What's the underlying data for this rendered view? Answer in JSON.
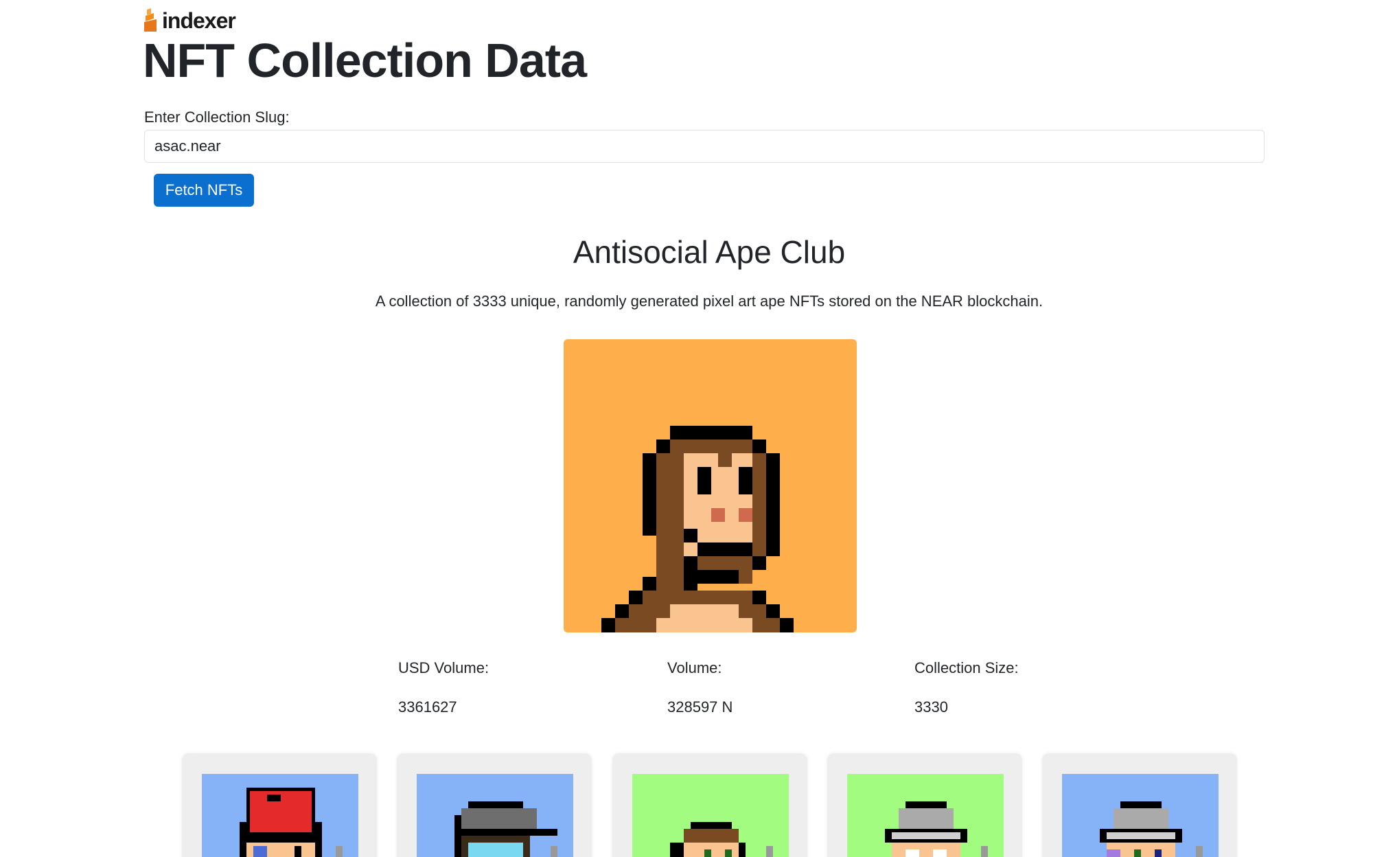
{
  "logo": {
    "text": "indexer",
    "color": "#f28c1c"
  },
  "page_title": "NFT Collection Data",
  "form": {
    "label": "Enter Collection Slug:",
    "input_value": "asac.near",
    "button_label": "Fetch NFTs"
  },
  "collection": {
    "name": "Antisocial Ape Club",
    "description": "A collection of 3333 unique, randomly generated pixel art ape NFTs stored on the NEAR blockchain.",
    "image_background": "#ffae4c",
    "stats": [
      {
        "label": "USD Volume:",
        "value": "3361627"
      },
      {
        "label": "Volume:",
        "value": "328597 N"
      },
      {
        "label": "Collection Size:",
        "value": "3330"
      }
    ]
  },
  "nft_cards": [
    {
      "background": "#86b3f7",
      "headwear": "red-cap"
    },
    {
      "background": "#86b3f7",
      "headwear": "gray-helmet"
    },
    {
      "background": "#a2fc7f",
      "headwear": "none"
    },
    {
      "background": "#a2fc7f",
      "headwear": "gray-beanie"
    },
    {
      "background": "#86b3f7",
      "headwear": "gray-beanie"
    }
  ],
  "colors": {
    "primary_button": "#0b6fd0",
    "fur": "#7a4a23",
    "skin": "#f9c48f",
    "nose": "#d06a4f"
  }
}
